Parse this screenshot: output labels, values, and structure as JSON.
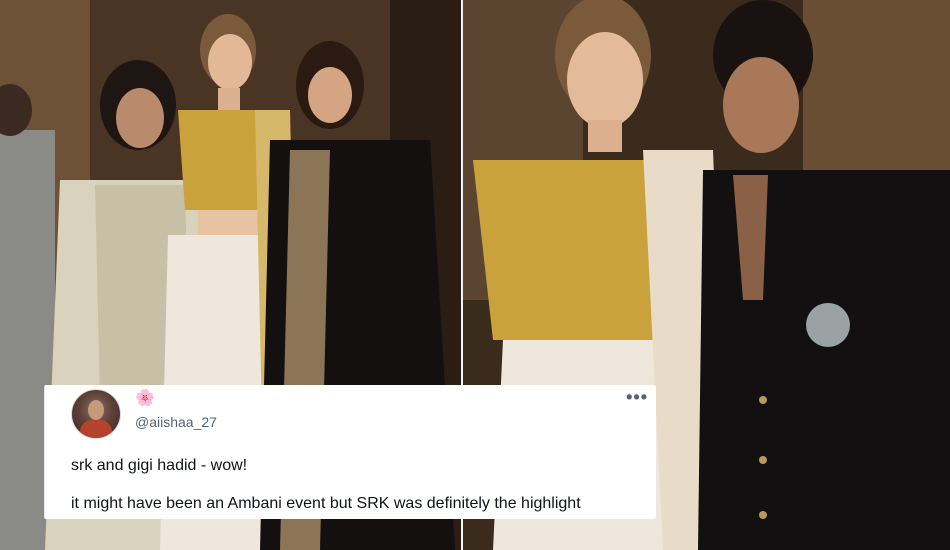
{
  "tweet": {
    "avatar_icon": "user-avatar",
    "emoji_icon": "cherry-blossom-icon",
    "emoji": "🌸",
    "handle": "@aiishaa_27",
    "more_icon": "more-options-icon",
    "more_glyph": "•••",
    "line1": "srk and gigi hadid - wow!",
    "line2": "it might have been an Ambani event but SRK was definitely the highlight"
  },
  "colors": {
    "accent": "#e9b200",
    "handle": "#536471",
    "text": "#0f1419"
  }
}
